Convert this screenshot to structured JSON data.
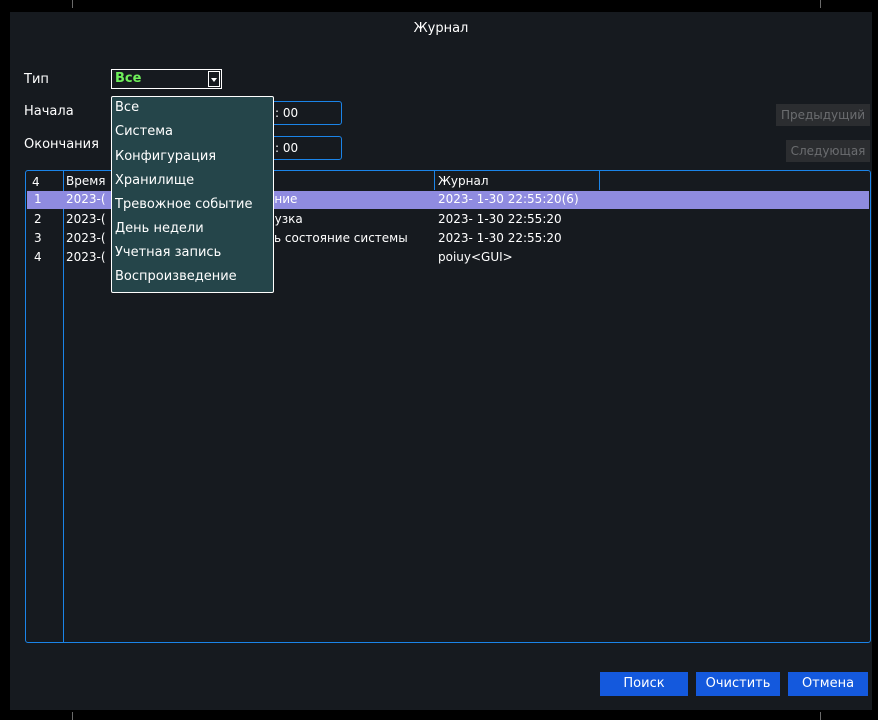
{
  "title": "Журнал",
  "filters": {
    "type_label": "Тип",
    "type_value": "Все",
    "start_label": "Начала",
    "end_label": "Окончания",
    "start_time_partial": ": 00",
    "end_time_partial": ": 00"
  },
  "nav": {
    "prev_label": "Предыдущий",
    "next_label": "Следующая"
  },
  "dropdown": {
    "options": [
      "Все",
      "Система",
      "Конфигурация",
      "Хранилище",
      "Тревожное событие",
      "День недели",
      "Учетная запись",
      "Воспроизведение"
    ]
  },
  "table": {
    "count": "4",
    "headers": {
      "time": "Время",
      "journal": "Журнал"
    },
    "rows": [
      {
        "num": "1",
        "time": "2023-(",
        "event": "ение",
        "journal": "2023- 1-30 22:55:20(6)",
        "selected": true
      },
      {
        "num": "2",
        "time": "2023-(",
        "event": "рузка",
        "journal": "2023- 1-30 22:55:20",
        "selected": false
      },
      {
        "num": "3",
        "time": "2023-(",
        "event": "ть состояние системы",
        "journal": "2023- 1-30 22:55:20",
        "selected": false
      },
      {
        "num": "4",
        "time": "2023-(",
        "event": "",
        "journal": "poiuy<GUI>",
        "selected": false
      }
    ]
  },
  "buttons": {
    "search": "Поиск",
    "clear": "Очистить",
    "cancel": "Отмена"
  },
  "colors": {
    "accent": "#1b84e8",
    "selected_row": "#8f8be0",
    "button": "#1459dd",
    "dropdown_bg": "#25454a",
    "select_value": "#6ff05a"
  }
}
